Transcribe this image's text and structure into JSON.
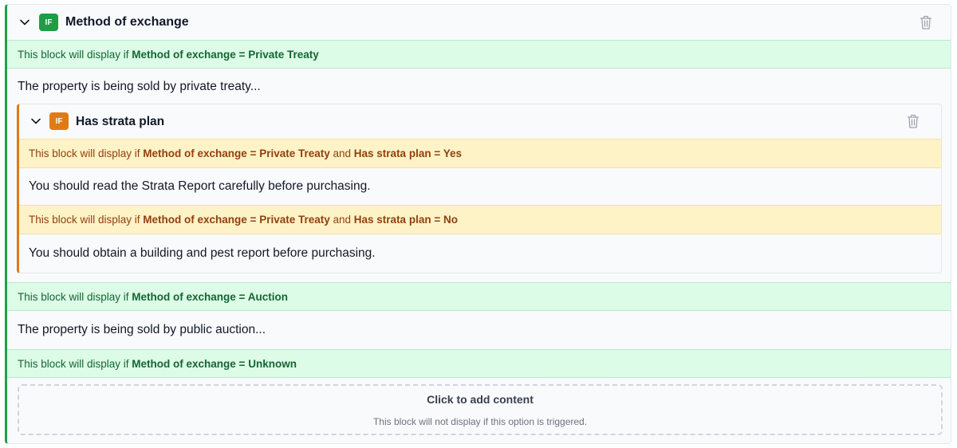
{
  "outer_block": {
    "badge": "IF",
    "title": "Method of exchange",
    "branches": [
      {
        "prefix": "This block will display if ",
        "condition": "Method of exchange = Private Treaty",
        "content": "The property is being sold by private treaty..."
      },
      {
        "prefix": "This block will display if ",
        "condition": "Method of exchange = Auction",
        "content": "The property is being sold by public auction..."
      },
      {
        "prefix": "This block will display if ",
        "condition": "Method of exchange = Unknown"
      }
    ]
  },
  "inner_block": {
    "badge": "IF",
    "title": "Has strata plan",
    "branches": [
      {
        "prefix": "This block will display if ",
        "condition_a": "Method of exchange = Private Treaty",
        "joiner": " and ",
        "condition_b": "Has strata plan = Yes",
        "content": "You should read the Strata Report carefully before purchasing."
      },
      {
        "prefix": "This block will display if ",
        "condition_a": "Method of exchange = Private Treaty",
        "joiner": " and ",
        "condition_b": "Has strata plan = No",
        "content": "You should obtain a building and pest report before purchasing."
      }
    ]
  },
  "add_content": {
    "title": "Click to add content",
    "subtitle": "This block will not display if this option is triggered."
  },
  "colors": {
    "outer_accent": "#22a04b",
    "inner_accent": "#e07b13",
    "green_banner": "#dcfce7",
    "yellow_banner": "#fef3c7"
  },
  "icons": [
    "chevron-down-icon",
    "trash-icon"
  ]
}
